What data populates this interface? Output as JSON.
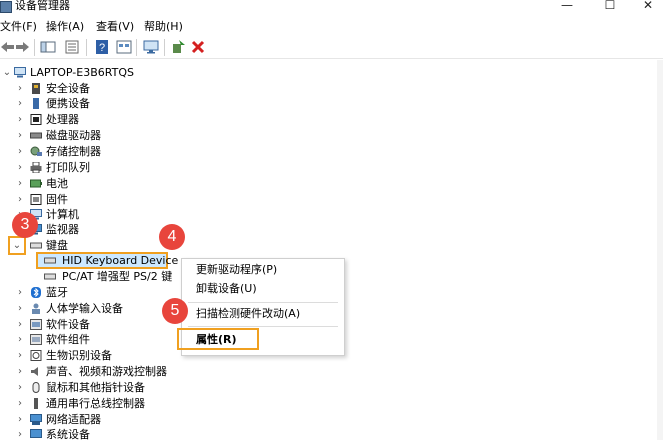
{
  "window": {
    "title": "设备管理器",
    "minimize": "—",
    "maximize": "☐",
    "close": "✕"
  },
  "menu": [
    "文件(F)",
    "操作(A)",
    "查看(V)",
    "帮助(H)"
  ],
  "tree": {
    "root": "LAPTOP-E3B6RTQS",
    "items": [
      {
        "label": "安全设备"
      },
      {
        "label": "便携设备"
      },
      {
        "label": "处理器"
      },
      {
        "label": "磁盘驱动器"
      },
      {
        "label": "存储控制器"
      },
      {
        "label": "打印队列"
      },
      {
        "label": "电池"
      },
      {
        "label": "固件"
      },
      {
        "label": "计算机"
      },
      {
        "label": "监视器"
      },
      {
        "label": "键盘"
      },
      {
        "label": "HID Keyboard Device"
      },
      {
        "label": "PC/AT 增强型 PS/2 键"
      },
      {
        "label": "蓝牙"
      },
      {
        "label": "人体学输入设备"
      },
      {
        "label": "软件设备"
      },
      {
        "label": "软件组件"
      },
      {
        "label": "生物识别设备"
      },
      {
        "label": "声音、视频和游戏控制器"
      },
      {
        "label": "鼠标和其他指针设备"
      },
      {
        "label": "通用串行总线控制器"
      },
      {
        "label": "网络适配器"
      },
      {
        "label": "系统设备"
      }
    ]
  },
  "context_menu": {
    "update_driver": "更新驱动程序(P)",
    "uninstall": "卸载设备(U)",
    "scan": "扫描检测硬件改动(A)",
    "properties": "属性(R)"
  },
  "steps": {
    "s3": "3",
    "s4": "4",
    "s5": "5"
  },
  "colors": {
    "badge": "#e8453c",
    "highlight": "#f0a020",
    "selection": "#cce8ff"
  }
}
